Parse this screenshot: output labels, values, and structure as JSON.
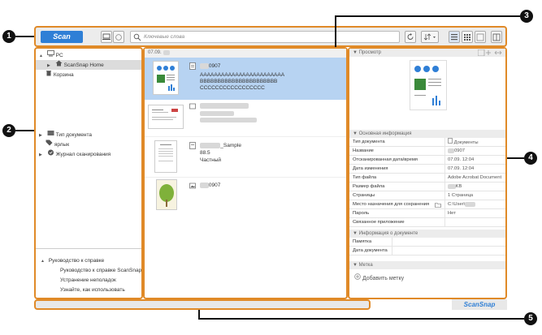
{
  "toolbar": {
    "scan_label": "Scan",
    "search_placeholder": "Ключевые слова"
  },
  "left_tree": {
    "pc": "PC",
    "home": "ScanSnap Home",
    "trash": "Корзина",
    "doc_type": "Тип документа",
    "label": "ярлык",
    "scan_log": "Журнал сканирования"
  },
  "help": {
    "header": "Руководство к справке",
    "items": [
      "Руководство к справке ScanSnap",
      "Устранение неполадок",
      "Узнайте, как использовать"
    ]
  },
  "list": {
    "date_group": "07.09.",
    "files": [
      {
        "name": "0907",
        "lines": [
          "AAAAAAAAAAAAAAAAAAAAAAAA",
          "BBBBBBBBBBBBBBBBBBBBBB",
          "CCCCCCCCCCCCCCCCC"
        ]
      },
      {
        "name": "",
        "lines": []
      },
      {
        "name": "_Sample",
        "lines": [
          "88.5",
          "Частный"
        ]
      },
      {
        "name": "0907",
        "lines": []
      }
    ]
  },
  "preview": {
    "header": "Просмотр"
  },
  "basic": {
    "header": "Основная информация",
    "rows": [
      {
        "k": "Тип документа",
        "v": "Документы"
      },
      {
        "k": "Название",
        "v": "0907"
      },
      {
        "k": "Отсканированная дата/время",
        "v": "07.09.         12:04"
      },
      {
        "k": "Дата изменения",
        "v": "07.09.         12:04"
      },
      {
        "k": "Тип файла",
        "v": "Adobe Acrobat Document"
      },
      {
        "k": "Размер файла",
        "v": "KB"
      },
      {
        "k": "Страницы",
        "v": "1 Страница"
      },
      {
        "k": "Место назначения для сохранения",
        "v": "C:\\User\\"
      },
      {
        "k": "Пароль",
        "v": "Нет"
      },
      {
        "k": "Связанное приложение",
        "v": ""
      }
    ]
  },
  "docinfo": {
    "header": "Информация о документе",
    "rows": [
      {
        "k": "Памятка",
        "v": ""
      },
      {
        "k": "Дата документа",
        "v": ""
      }
    ]
  },
  "tags": {
    "header": "Метка",
    "add": "Добавить метку"
  },
  "brand": "ScanSnap",
  "callouts": [
    "1",
    "2",
    "3",
    "4",
    "5"
  ]
}
